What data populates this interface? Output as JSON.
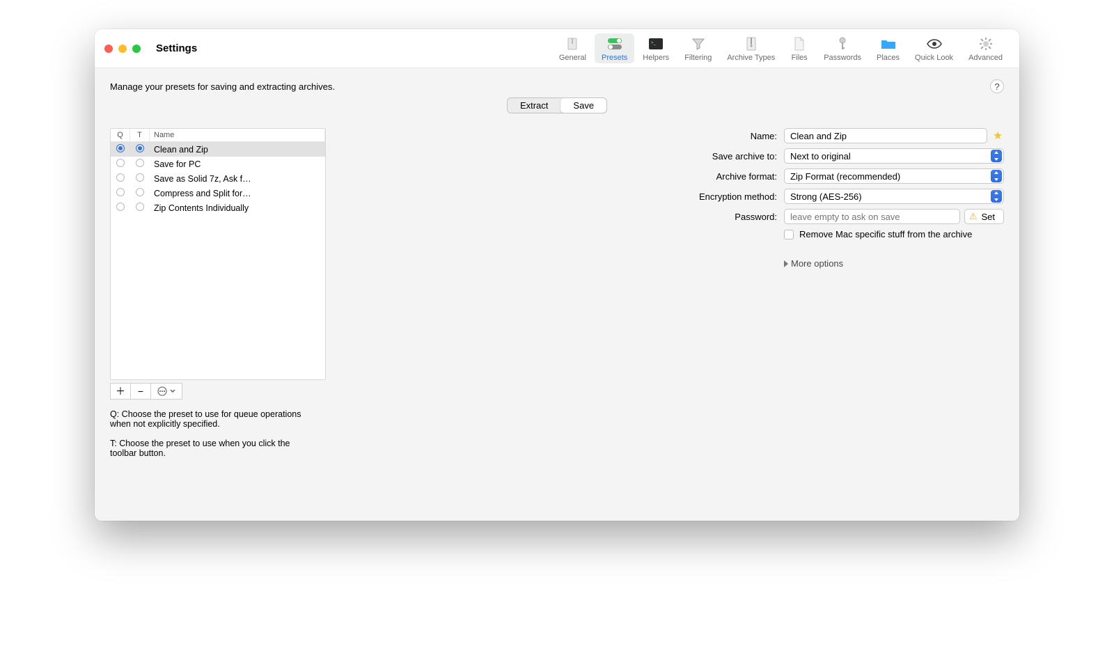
{
  "window": {
    "title": "Settings"
  },
  "toolbar": {
    "items": [
      {
        "id": "general",
        "label": "General"
      },
      {
        "id": "presets",
        "label": "Presets"
      },
      {
        "id": "helpers",
        "label": "Helpers"
      },
      {
        "id": "filtering",
        "label": "Filtering"
      },
      {
        "id": "archtypes",
        "label": "Archive Types"
      },
      {
        "id": "files",
        "label": "Files"
      },
      {
        "id": "passwords",
        "label": "Passwords"
      },
      {
        "id": "places",
        "label": "Places"
      },
      {
        "id": "quicklook",
        "label": "Quick Look"
      },
      {
        "id": "advanced",
        "label": "Advanced"
      }
    ],
    "active_id": "presets"
  },
  "description": "Manage your presets for saving and extracting archives.",
  "segmented": {
    "options": [
      "Extract",
      "Save"
    ],
    "active_index": 1
  },
  "presets": {
    "columns": {
      "q": "Q",
      "t": "T",
      "name": "Name"
    },
    "rows": [
      {
        "q": true,
        "t": true,
        "name": "Clean and Zip",
        "selected": true
      },
      {
        "q": false,
        "t": false,
        "name": "Save for PC"
      },
      {
        "q": false,
        "t": false,
        "name": "Save as Solid 7z, Ask f…"
      },
      {
        "q": false,
        "t": false,
        "name": "Compress and Split for…"
      },
      {
        "q": false,
        "t": false,
        "name": "Zip Contents Individually"
      }
    ],
    "hint_q": "Q: Choose the preset to use for queue operations when not explicitly specified.",
    "hint_t": "T: Choose the preset to use when you click the toolbar button."
  },
  "form": {
    "name_label": "Name:",
    "name_value": "Clean and Zip",
    "save_to_label": "Save archive to:",
    "save_to_value": "Next to original",
    "format_label": "Archive format:",
    "format_value": "Zip Format (recommended)",
    "encryption_label": "Encryption method:",
    "encryption_value": "Strong (AES-256)",
    "password_label": "Password:",
    "password_placeholder": "leave empty to ask on save",
    "password_value": "",
    "set_button": "Set",
    "remove_mac_label": "Remove Mac specific stuff from the archive",
    "more_options": "More options"
  },
  "buttons": {
    "help": "?"
  }
}
